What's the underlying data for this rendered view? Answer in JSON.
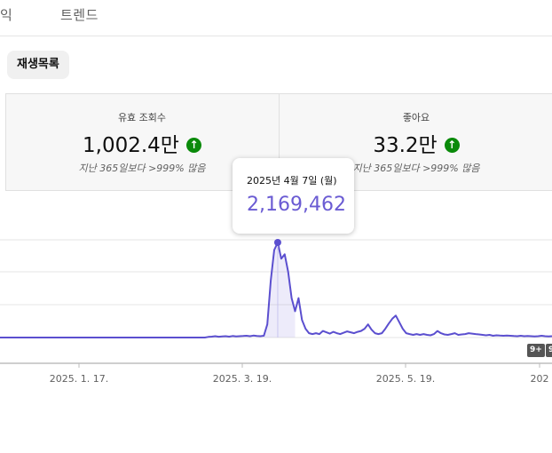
{
  "tabs": [
    "익",
    "트렌드"
  ],
  "playlist_chip": "재생목록",
  "metrics": [
    {
      "label": "유효 조회수",
      "value": "1,002.4만",
      "comparison": "지난 365일보다 >999% 많음"
    },
    {
      "label": "좋아요",
      "value": "33.2만",
      "comparison": "지난 365일보다 >999% 많음"
    }
  ],
  "tooltip": {
    "date": "2025년 4월 7일 (월)",
    "value": "2,169,462"
  },
  "badges": [
    "9+",
    "9"
  ],
  "colors": {
    "series": "#5b4fcf",
    "up_arrow": "#0a8a0a"
  },
  "icons": {
    "trend_up": "arrow-up-circle-icon"
  },
  "chart_data": {
    "type": "area",
    "x_tick_labels": [
      "2025. 1. 17.",
      "2025. 3. 19.",
      "2025. 5. 19.",
      "202"
    ],
    "series": [
      {
        "values": [
          0,
          0,
          0,
          0,
          0,
          0,
          0,
          0,
          0,
          0,
          0,
          0,
          0,
          0,
          0,
          0,
          0,
          0,
          0,
          0,
          0,
          0,
          0,
          0,
          0,
          0,
          0,
          0,
          0,
          0,
          0,
          0,
          0,
          0,
          0,
          0,
          0,
          0,
          0,
          0,
          0,
          0,
          0,
          0,
          0,
          0,
          0,
          0,
          0,
          0,
          0,
          0,
          0,
          0,
          0,
          0,
          0,
          0,
          0,
          0,
          15000,
          20000,
          30000,
          18000,
          25000,
          30000,
          20000,
          35000,
          25000,
          30000,
          35000,
          40000,
          30000,
          45000,
          35000,
          30000,
          40000,
          300000,
          1300000,
          2000000,
          2169462,
          1800000,
          1900000,
          1500000,
          900000,
          600000,
          900000,
          400000,
          200000,
          100000,
          80000,
          100000,
          80000,
          150000,
          120000,
          90000,
          130000,
          100000,
          80000,
          110000,
          140000,
          120000,
          100000,
          130000,
          150000,
          200000,
          300000,
          180000,
          100000,
          80000,
          100000,
          200000,
          320000,
          430000,
          500000,
          350000,
          200000,
          100000,
          80000,
          60000,
          80000,
          60000,
          80000,
          60000,
          50000,
          80000,
          150000,
          100000,
          70000,
          60000,
          80000,
          100000,
          60000,
          70000,
          80000,
          100000,
          90000,
          80000,
          70000,
          60000,
          50000,
          60000,
          40000,
          50000,
          45000,
          40000,
          45000,
          40000,
          35000,
          30000,
          40000,
          30000,
          35000,
          30000,
          25000,
          30000,
          40000,
          30000,
          25000,
          30000
        ]
      }
    ],
    "grid": true
  }
}
